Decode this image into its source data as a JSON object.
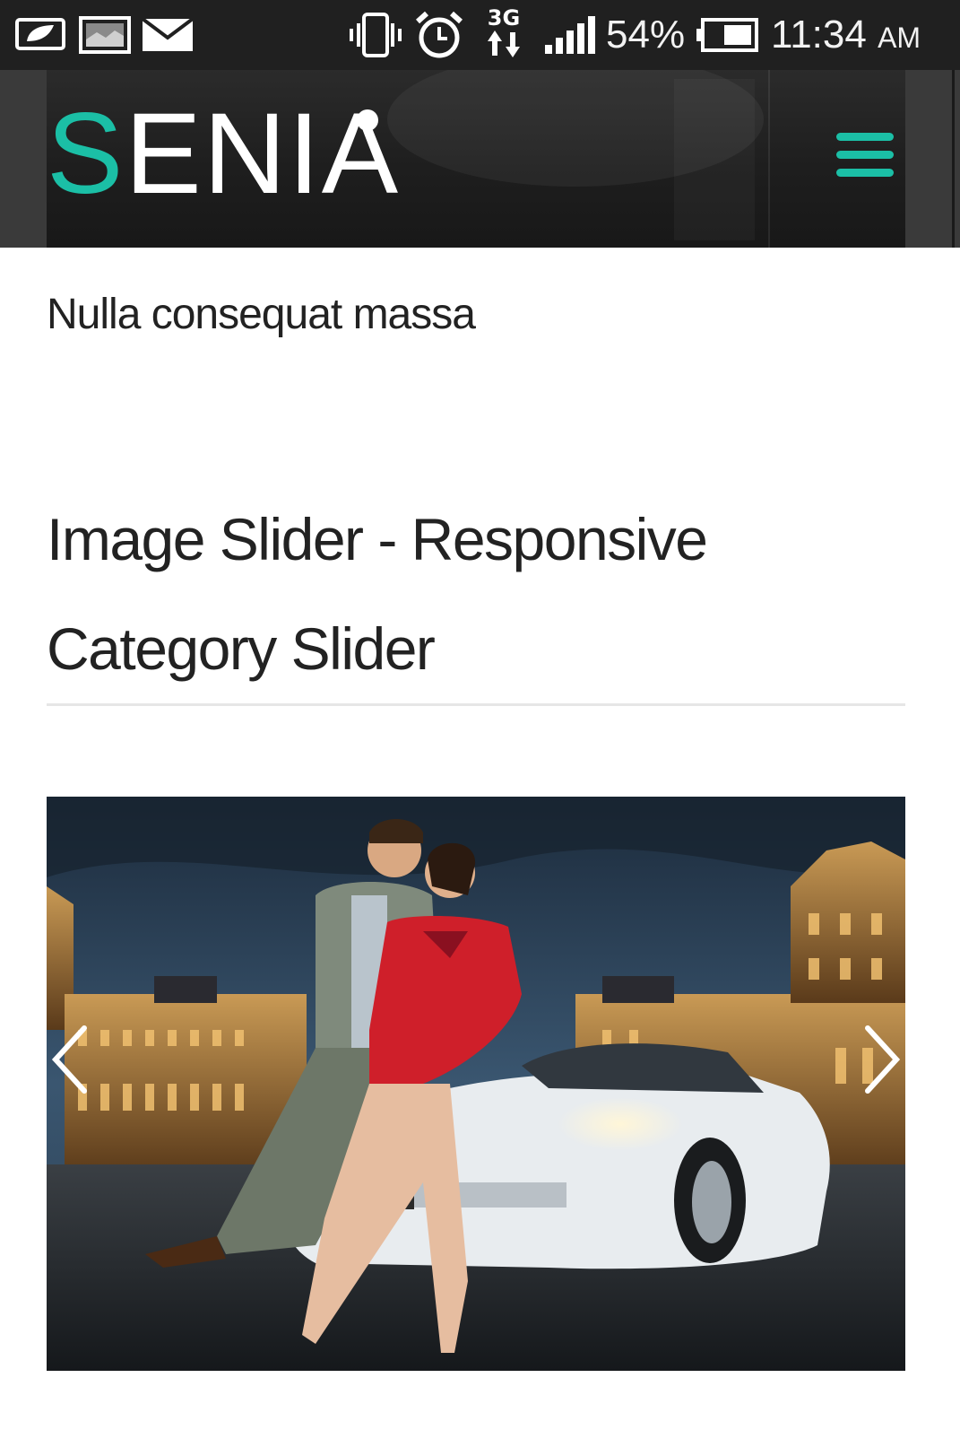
{
  "status_bar": {
    "battery_percent": "54%",
    "time": "11:34",
    "ampm": "AM",
    "network": "3G",
    "icons": [
      "battery-saver-icon",
      "gallery-icon",
      "mail-icon",
      "vibrate-icon",
      "alarm-icon",
      "network-3g-icon",
      "signal-icon",
      "battery-icon"
    ]
  },
  "header": {
    "logo_first": "S",
    "logo_rest": "ENIA",
    "menu_icon": "hamburger-menu-icon",
    "accent_color": "#1bbfa6"
  },
  "content": {
    "subtitle": "Nulla consequat massa",
    "heading": "Image Slider - Responsive Category Slider"
  },
  "slider": {
    "prev_icon": "chevron-left-icon",
    "next_icon": "chevron-right-icon"
  }
}
